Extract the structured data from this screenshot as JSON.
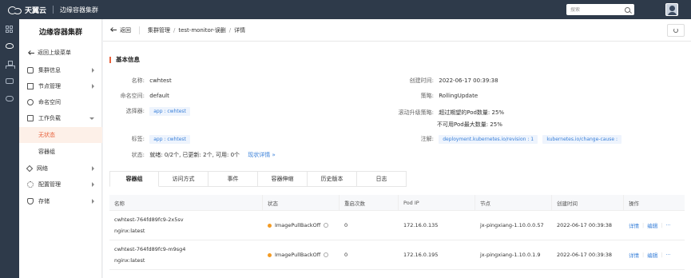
{
  "topbar": {
    "brand": "天翼云",
    "product": "边缘容器集群",
    "search_placeholder": "搜索"
  },
  "sidebar": {
    "title": "边缘容器集群",
    "back_label": "返回上级菜单",
    "items": [
      {
        "label": "集群信息"
      },
      {
        "label": "节点管理"
      },
      {
        "label": "命名空间"
      },
      {
        "label": "工作负载"
      },
      {
        "label": "网络"
      },
      {
        "label": "配置管理"
      },
      {
        "label": "存储"
      }
    ],
    "sub_items": [
      {
        "label": "无状态"
      },
      {
        "label": "容器组"
      }
    ]
  },
  "breadcrumb": {
    "back_label": "返回",
    "items": [
      "集群管理",
      "test-monitor-误删",
      "详情"
    ],
    "sep": "/"
  },
  "basic": {
    "title": "基本信息",
    "name_label": "名称:",
    "name": "cwhtest",
    "ns_label": "命名空间:",
    "ns": "default",
    "selector_label": "选择器:",
    "selector": "app : cwhtest",
    "tags_label": "标签:",
    "tags": "app : cwhtest",
    "status_label": "状态:",
    "status": "就绪: 0/2个, 已更新: 2个, 可用: 0个",
    "status_link": "现状详情 »",
    "created_label": "创建时间:",
    "created": "2022-06-17 00:39:38",
    "strategy_label": "策略:",
    "strategy": "RollingUpdate",
    "rolling_label": "滚动升级策略:",
    "max_surge": "超过期望的Pod数量:  25%",
    "max_unavailable": "不可用Pod最大数量:  25%",
    "annotations_label": "注解:",
    "annotation1": "deployment.kubernetes.io/revision : 1",
    "annotation2": "kubernetes.io/change-cause :"
  },
  "tabs": [
    "容器组",
    "访问方式",
    "事件",
    "容器伸缩",
    "历史版本",
    "日志"
  ],
  "table": {
    "headers": [
      "名称",
      "状态",
      "重启次数",
      "Pod IP",
      "节点",
      "创建时间",
      "操作"
    ],
    "rows": [
      {
        "name": "cwhtest-764fd89fc9-2x5sv",
        "image": "nginx:latest",
        "status": "ImagePullBackOff",
        "restarts": "0",
        "pod_ip": "172.16.0.135",
        "node": "jx-pingxiang-1.10.0.0.57",
        "created": "2022-06-17 00:39:38",
        "op_detail": "详情",
        "op_edit": "编辑",
        "op_more": "···"
      },
      {
        "name": "cwhtest-764fd89fc9-m9sg4",
        "image": "nginx:latest",
        "status": "ImagePullBackOff",
        "restarts": "0",
        "pod_ip": "172.16.0.195",
        "node": "jx-pingxiang-1.10.0.1.9",
        "created": "2022-06-17 00:39:38",
        "op_detail": "详情",
        "op_edit": "编辑",
        "op_more": "···"
      }
    ]
  },
  "colors": {
    "accent": "#e8623d",
    "link": "#3a80d9",
    "topbar": "#2e3a4a",
    "warning": "#f39b24"
  }
}
